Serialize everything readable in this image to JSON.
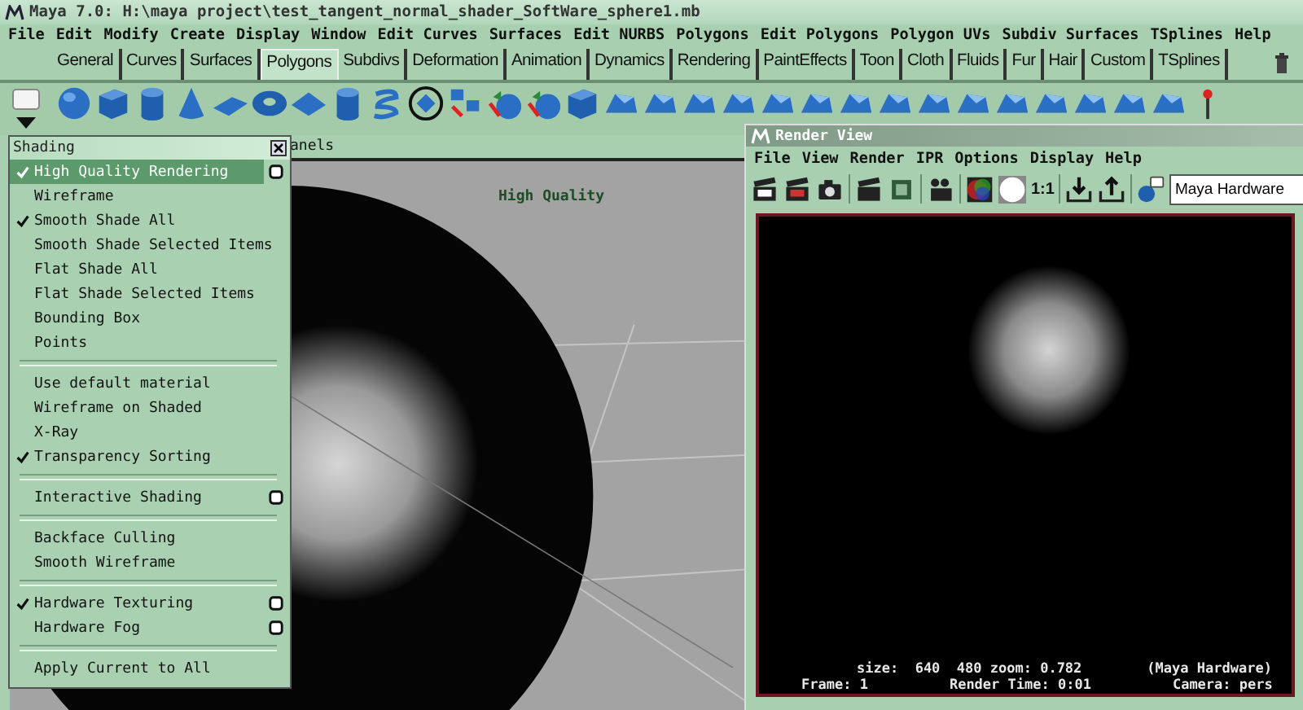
{
  "window": {
    "title": "Maya 7.0: H:\\maya project\\test_tangent_normal_shader_SoftWare_sphere1.mb"
  },
  "menu_bar": [
    "File",
    "Edit",
    "Modify",
    "Create",
    "Display",
    "Window",
    "Edit Curves",
    "Surfaces",
    "Edit NURBS",
    "Polygons",
    "Edit Polygons",
    "Polygon UVs",
    "Subdiv Surfaces",
    "TSplines",
    "Help"
  ],
  "shelf_tabs": [
    {
      "label": "General",
      "selected": false
    },
    {
      "label": "Curves",
      "selected": false
    },
    {
      "label": "Surfaces",
      "selected": false
    },
    {
      "label": "Polygons",
      "selected": true
    },
    {
      "label": "Subdivs",
      "selected": false
    },
    {
      "label": "Deformation",
      "selected": false
    },
    {
      "label": "Animation",
      "selected": false
    },
    {
      "label": "Dynamics",
      "selected": false
    },
    {
      "label": "Rendering",
      "selected": false
    },
    {
      "label": "PaintEffects",
      "selected": false
    },
    {
      "label": "Toon",
      "selected": false
    },
    {
      "label": "Cloth",
      "selected": false
    },
    {
      "label": "Fluids",
      "selected": false
    },
    {
      "label": "Fur",
      "selected": false
    },
    {
      "label": "Hair",
      "selected": false
    },
    {
      "label": "Custom",
      "selected": false
    },
    {
      "label": "TSplines",
      "selected": false
    }
  ],
  "viewport": {
    "header": "anels",
    "label": "High Quality"
  },
  "shading_menu": {
    "title": "Shading",
    "sections": [
      [
        {
          "label": "High Quality Rendering",
          "checked": true,
          "selected": true,
          "option_box": true
        },
        {
          "label": "Wireframe",
          "checked": false,
          "selected": false,
          "option_box": false
        },
        {
          "label": "Smooth Shade All",
          "checked": true,
          "selected": false,
          "option_box": false
        },
        {
          "label": "Smooth Shade Selected Items",
          "checked": false,
          "selected": false,
          "option_box": false
        },
        {
          "label": "Flat Shade All",
          "checked": false,
          "selected": false,
          "option_box": false
        },
        {
          "label": "Flat Shade Selected Items",
          "checked": false,
          "selected": false,
          "option_box": false
        },
        {
          "label": "Bounding Box",
          "checked": false,
          "selected": false,
          "option_box": false
        },
        {
          "label": "Points",
          "checked": false,
          "selected": false,
          "option_box": false
        }
      ],
      [
        {
          "label": "Use default material",
          "checked": false,
          "selected": false,
          "option_box": false
        },
        {
          "label": "Wireframe on Shaded",
          "checked": false,
          "selected": false,
          "option_box": false
        },
        {
          "label": "X-Ray",
          "checked": false,
          "selected": false,
          "option_box": false
        },
        {
          "label": "Transparency Sorting",
          "checked": true,
          "selected": false,
          "option_box": false
        }
      ],
      [
        {
          "label": "Interactive Shading",
          "checked": false,
          "selected": false,
          "option_box": true
        }
      ],
      [
        {
          "label": "Backface Culling",
          "checked": false,
          "selected": false,
          "option_box": false
        },
        {
          "label": "Smooth Wireframe",
          "checked": false,
          "selected": false,
          "option_box": false
        }
      ],
      [
        {
          "label": "Hardware Texturing",
          "checked": true,
          "selected": false,
          "option_box": true
        },
        {
          "label": "Hardware Fog",
          "checked": false,
          "selected": false,
          "option_box": true
        }
      ],
      [
        {
          "label": "Apply Current to All",
          "checked": false,
          "selected": false,
          "option_box": false
        }
      ]
    ]
  },
  "render_view": {
    "title": "Render View",
    "menu": [
      "File",
      "View",
      "Render",
      "IPR",
      "Options",
      "Display",
      "Help"
    ],
    "ratio_label": "1:1",
    "renderer": "Maya Hardware",
    "status": {
      "size": "size:  640  480 zoom: 0.782",
      "renderer": "(Maya Hardware)",
      "frame": "Frame: 1",
      "render_time": "Render Time: 0:01",
      "camera": "Camera: pers"
    }
  }
}
